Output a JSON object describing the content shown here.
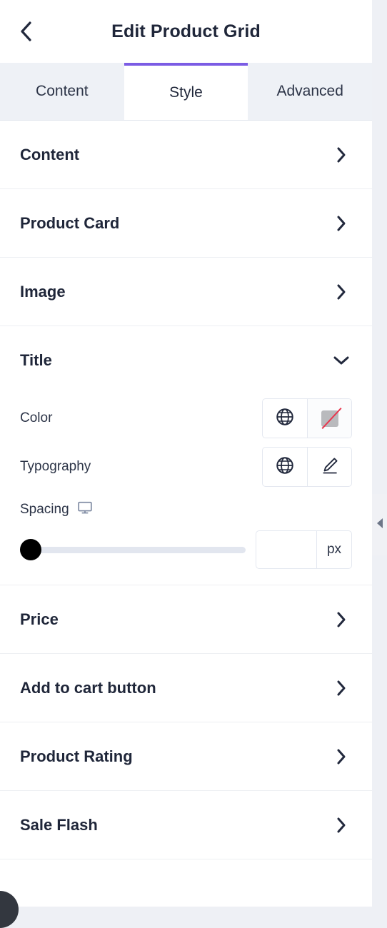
{
  "header": {
    "back_icon": "chevron-left-icon",
    "title": "Edit Product Grid"
  },
  "tabs": [
    {
      "label": "Content",
      "active": false
    },
    {
      "label": "Style",
      "active": true
    },
    {
      "label": "Advanced",
      "active": false
    }
  ],
  "accordion": {
    "collapsed_icon": "chevron-right-icon",
    "expanded_icon": "chevron-down-icon",
    "sections": [
      {
        "label": "Content",
        "expanded": false
      },
      {
        "label": "Product Card",
        "expanded": false
      },
      {
        "label": "Image",
        "expanded": false
      },
      {
        "label": "Title",
        "expanded": true
      },
      {
        "label": "Price",
        "expanded": false
      },
      {
        "label": "Add to cart button",
        "expanded": false
      },
      {
        "label": "Product Rating",
        "expanded": false
      },
      {
        "label": "Sale Flash",
        "expanded": false
      }
    ]
  },
  "title_section": {
    "color": {
      "label": "Color",
      "globe_icon": "globe-icon",
      "swatch_icon": "no-color-swatch-icon",
      "swatch_color": "#b9babd",
      "slash_color": "#e8384f"
    },
    "typography": {
      "label": "Typography",
      "globe_icon": "globe-icon",
      "edit_icon": "pencil-edit-icon"
    },
    "spacing": {
      "label": "Spacing",
      "responsive_icon": "desktop-monitor-icon",
      "slider_value": 0,
      "slider_min": 0,
      "slider_max": 100,
      "input_value": "",
      "input_placeholder": "",
      "unit": "px"
    }
  },
  "collapse_handle": {
    "icon": "caret-left-icon"
  },
  "colors": {
    "accent": "#7b5ce4",
    "panel_bg": "#ffffff",
    "canvas_bg": "#eef0f5",
    "tab_bg": "#eef1f6",
    "text": "#1f2639",
    "divider": "#edeff3"
  }
}
